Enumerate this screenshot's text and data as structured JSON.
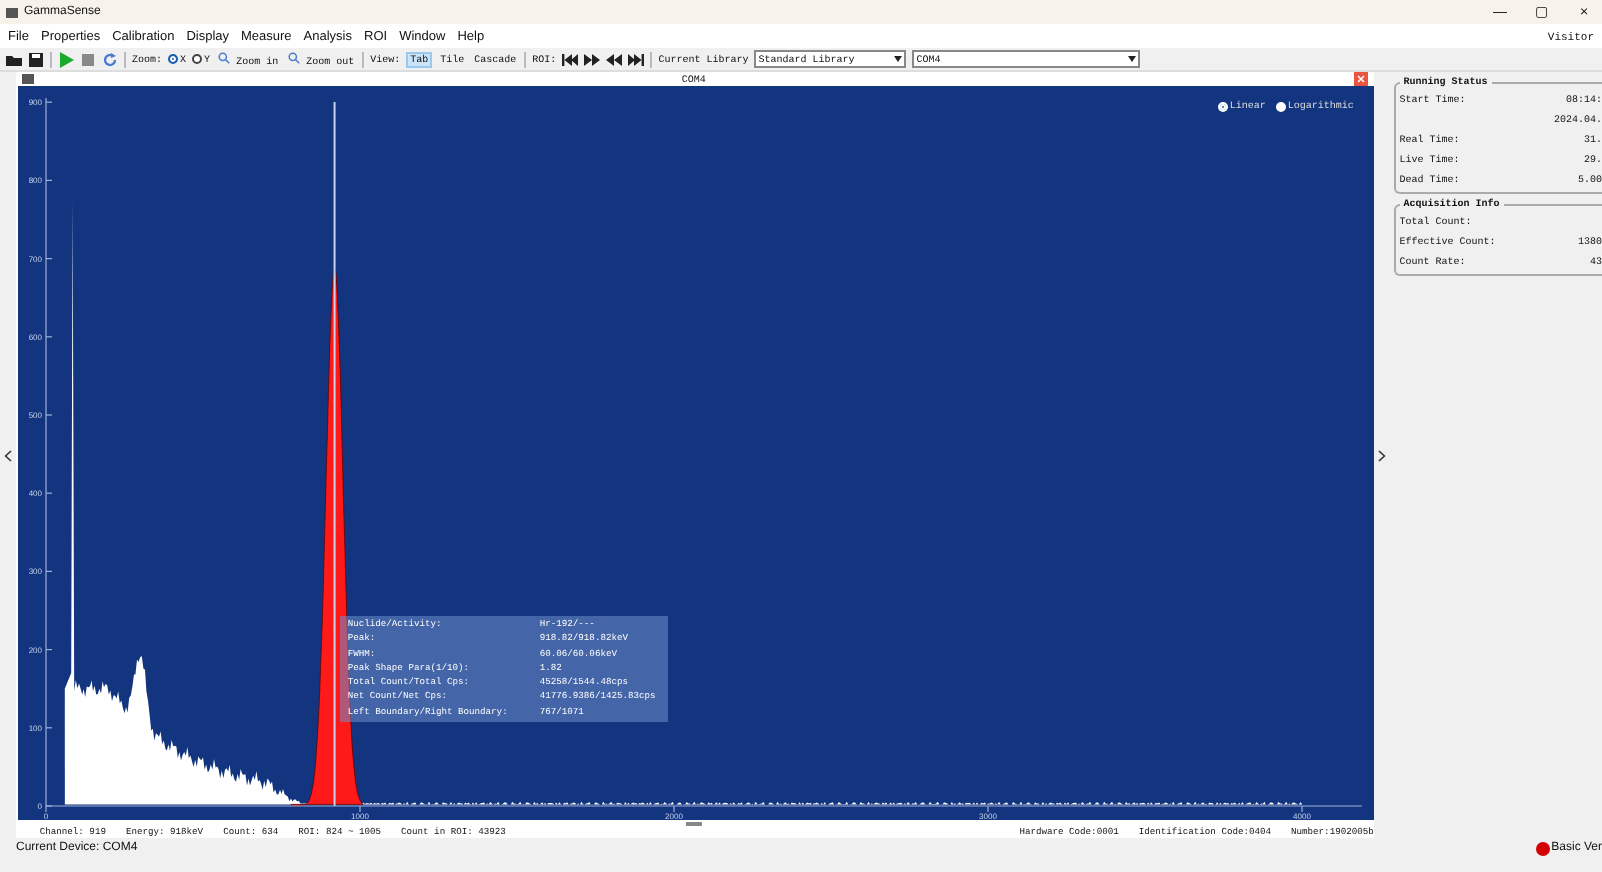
{
  "window": {
    "title": "GammaSense",
    "controls": [
      "—",
      "▢",
      "×"
    ]
  },
  "menu": [
    "File",
    "Properties",
    "Calibration",
    "Display",
    "Measure",
    "Analysis",
    "ROI",
    "Window",
    "Help"
  ],
  "user": "Visitor",
  "toolbar": {
    "zoom_label": "Zoom:",
    "zoom_options": [
      {
        "label": "X",
        "selected": true
      },
      {
        "label": "Y",
        "selected": false
      }
    ],
    "zoom_in": "Zoom in",
    "zoom_out": "Zoom out",
    "view_label": "View:",
    "view_options": [
      {
        "label": "Tab",
        "selected": true
      },
      {
        "label": "Tile",
        "selected": false
      },
      {
        "label": "Cascade",
        "selected": false
      }
    ],
    "roi_label": "ROI:",
    "library_label": "Current Library",
    "library_value": "Standard Library",
    "device_value": "COM4"
  },
  "document": {
    "title": "COM4"
  },
  "chart": {
    "scale_options": [
      {
        "label": "Linear",
        "selected": true
      },
      {
        "label": "Logarithmic",
        "selected": false
      }
    ],
    "y_ticks": [
      "900",
      "800",
      "700",
      "600",
      "500",
      "400",
      "300",
      "200",
      "100",
      "0"
    ],
    "x_ticks": [
      "0",
      "1000",
      "2000",
      "3000",
      "4000"
    ]
  },
  "peak_info": [
    {
      "label": "Nuclide/Activity:",
      "value": "Hr-192/---"
    },
    {
      "label": "Peak:",
      "value": "918.82/918.82keV"
    },
    {
      "label": "FWHM:",
      "value": "60.06/60.06keV"
    },
    {
      "label": "Peak Shape Para(1/10):",
      "value": "1.82"
    },
    {
      "label": "Total Count/Total Cps:",
      "value": "45258/1544.48cps"
    },
    {
      "label": "Net Count/Net Cps:",
      "value": "41776.9386/1425.83cps"
    },
    {
      "label": "Left Boundary/Right Boundary:",
      "value": "767/1071"
    }
  ],
  "chart_status": {
    "left": [
      "Channel: 919",
      "Energy: 918keV",
      "Count: 634",
      "ROI: 824 ~ 1005",
      "Count in ROI: 43923"
    ],
    "right": [
      "Hardware Code:0001",
      "Identification Code:0404",
      "Number:1902005b"
    ]
  },
  "running_status": {
    "title": "Running Status",
    "rows": [
      {
        "label": "Start Time:",
        "value": "08:14:"
      },
      {
        "label": "",
        "value": "2024.04."
      },
      {
        "label": "Real Time:",
        "value": "31."
      },
      {
        "label": "Live Time:",
        "value": "29."
      },
      {
        "label": "Dead Time:",
        "value": "5.00"
      }
    ]
  },
  "acquisition_info": {
    "title": "Acquisition Info",
    "rows": [
      {
        "label": "Total Count:",
        "value": ""
      },
      {
        "label": "Effective Count:",
        "value": "1380"
      },
      {
        "label": "Count Rate:",
        "value": "43"
      }
    ]
  },
  "status_bar": {
    "device": "Current Device: COM4",
    "version": "Basic Ver"
  }
}
